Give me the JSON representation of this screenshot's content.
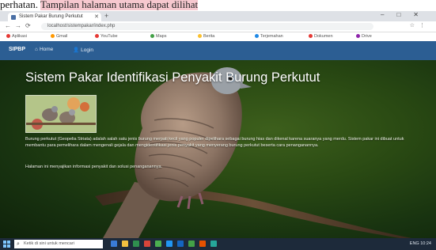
{
  "caption": {
    "text_plain": "perhatan.",
    "text_highlight": "Tampilan halaman utama dapat dilihat"
  },
  "browser": {
    "tab_title": "Sistem Pakar Burung Perkutut",
    "address": "localhost/sistempakar/index.php",
    "bookmarks": [
      "Aplikasi",
      "Gmail",
      "YouTube",
      "Maps",
      "Berita",
      "Terjemahan",
      "Dokumen",
      "Drive"
    ]
  },
  "site": {
    "brand": "SIPBP",
    "nav": [
      {
        "label": "Home",
        "icon": "home-icon"
      },
      {
        "label": "Login",
        "icon": "user-icon"
      }
    ],
    "title": "Sistem Pakar Identifikasi Penyakit Burung Perkutut",
    "paragraph": "Burung perkutut (Geopelia Striata) adalah salah satu jenis burung merpati kecil yang populer dipelihara sebagai burung hias dan dikenal karena suaranya yang merdu. Sistem pakar ini dibuat untuk membantu para pemelihara dalam mengenali gejala dan mengidentifikasi jenis penyakit yang menyerang burung perkutut beserta cara penanganannya.",
    "paragraph2": "Halaman ini menyajikan informasi penyakit dan solusi penanganannya."
  },
  "taskbar": {
    "search_placeholder": "Ketik di sini untuk mencari",
    "tray_text": "ENG 10:24"
  },
  "colors": {
    "nav": "#2c5e93",
    "highlight": "#f6c8cf",
    "taskbar": "#1d2a3a"
  }
}
